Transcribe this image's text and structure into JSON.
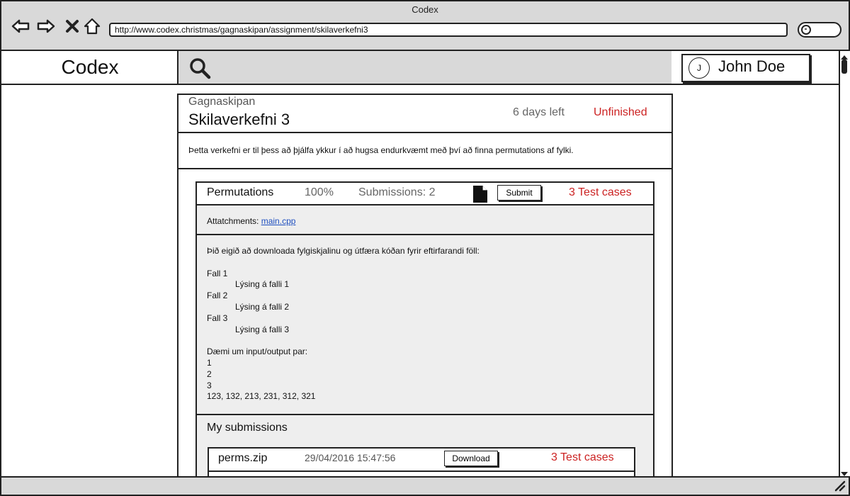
{
  "window": {
    "title": "Codex"
  },
  "browser": {
    "url": "http://www.codex.christmas/gagnaskipan/assignment/skilaverkefni3",
    "icons": [
      "back-icon",
      "forward-icon",
      "close-icon",
      "home-icon",
      "search-icon"
    ]
  },
  "app": {
    "logo": "Codex",
    "search_icon": "search-icon",
    "user": {
      "initial": "J",
      "name": "John Doe"
    }
  },
  "assignment": {
    "course": "Gagnaskipan",
    "title": "Skilaverkefni 3",
    "time_left": "6 days left",
    "status": "Unfinished",
    "description": "Þetta verkefni er til þess að þjálfa ykkur í að hugsa endurkvæmt með því að finna permutations af fylki."
  },
  "problem": {
    "name": "Permutations",
    "percent": "100%",
    "submissions": "Submissions: 2",
    "submit_label": "Submit",
    "test_cases": "3 Test cases",
    "attachments_label": "Attatchments:",
    "attachment_file": "main.cpp",
    "body": "Þið eigið að downloada fylgiskjalinu og útfæra kóðan fyrir eftirfarandi föll:\n\nFall 1\n            Lýsing á falli 1\nFall 2\n            Lýsing á falli 2\nFall 3\n            Lýsing á falli 3\n\nDæmi um input/output par:\n1\n2\n3\n123, 132, 213, 231, 312, 321"
  },
  "my_submissions": {
    "heading": "My submissions",
    "items": [
      {
        "file": "perms.zip",
        "date": "29/04/2016 15:47:56",
        "download_label": "Download",
        "test_cases": "3 Test cases"
      }
    ]
  },
  "colors": {
    "chrome": "#d9d9d9",
    "danger": "#cc2222",
    "link": "#1f4fbf"
  }
}
